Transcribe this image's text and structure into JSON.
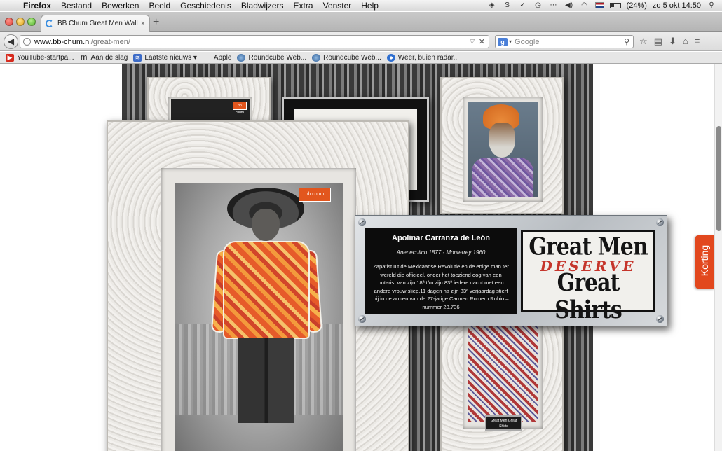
{
  "menubar": {
    "app": "Firefox",
    "items": [
      "Bestand",
      "Bewerken",
      "Beeld",
      "Geschiedenis",
      "Bladwijzers",
      "Extra",
      "Venster",
      "Help"
    ],
    "battery": "(24%)",
    "datetime": "zo 5 okt  14:50"
  },
  "tab": {
    "title": "BB Chum Great Men Wall ...",
    "close": "×",
    "new_tab": "+"
  },
  "nav": {
    "back": "◀",
    "url_host": "www.bb-chum.nl",
    "url_path": "/great-men/",
    "url_dropdown": "▽",
    "url_clear": "✕",
    "search_engine": "g",
    "search_caret": "▾",
    "search_placeholder": "Google",
    "search_icon": "⚲",
    "icons": [
      "☆",
      "▤",
      "⬇",
      "⌂",
      "≡"
    ]
  },
  "bookmarks": [
    {
      "label": "YouTube-startpa...",
      "icon": "youtube-icon",
      "glyph": "▶",
      "cls": "yt"
    },
    {
      "label": "Aan de slag",
      "icon": "m-icon",
      "glyph": "m",
      "cls": "m"
    },
    {
      "label": "Laatste nieuws ▾",
      "icon": "rss-icon",
      "glyph": "≋",
      "cls": "rss"
    },
    {
      "label": "Apple",
      "icon": "apple-icon",
      "glyph": "",
      "cls": "ap"
    },
    {
      "label": "Roundcube Web...",
      "icon": "roundcube-icon",
      "glyph": "",
      "cls": "rc"
    },
    {
      "label": "Roundcube Web...",
      "icon": "roundcube-icon",
      "glyph": "",
      "cls": "rc"
    },
    {
      "label": "Weer, buien radar...",
      "icon": "weather-icon",
      "glyph": "",
      "cls": "wr"
    }
  ],
  "page": {
    "brand_tag": "bb chum",
    "info": {
      "name": "Apolinar Carranza de León",
      "dates": "Anenecuilco 1877 - Monterrey 1960",
      "bio": "Zapatist uit de Mexicaanse Revolutie en de enige man ter wereld die officieel, onder het toeziend oog van een notaris, van zijn 18ª t/m zijn 83ª iedere nacht met een andere vrouw sliep.11 dagen na zijn 83ª verjaardag stierf hij in de armen van de 27-jarige Carmen Romero Rubio – nummer 23.736"
    },
    "slogan": {
      "line1": "Great Men",
      "line2": "DESERVE",
      "line3": "Great Shirts"
    },
    "korting": "Korting",
    "mini_logo": "Great Men Great Shirts",
    "colors": {
      "accent": "#e2481e",
      "slogan_red": "#c5352b"
    }
  }
}
